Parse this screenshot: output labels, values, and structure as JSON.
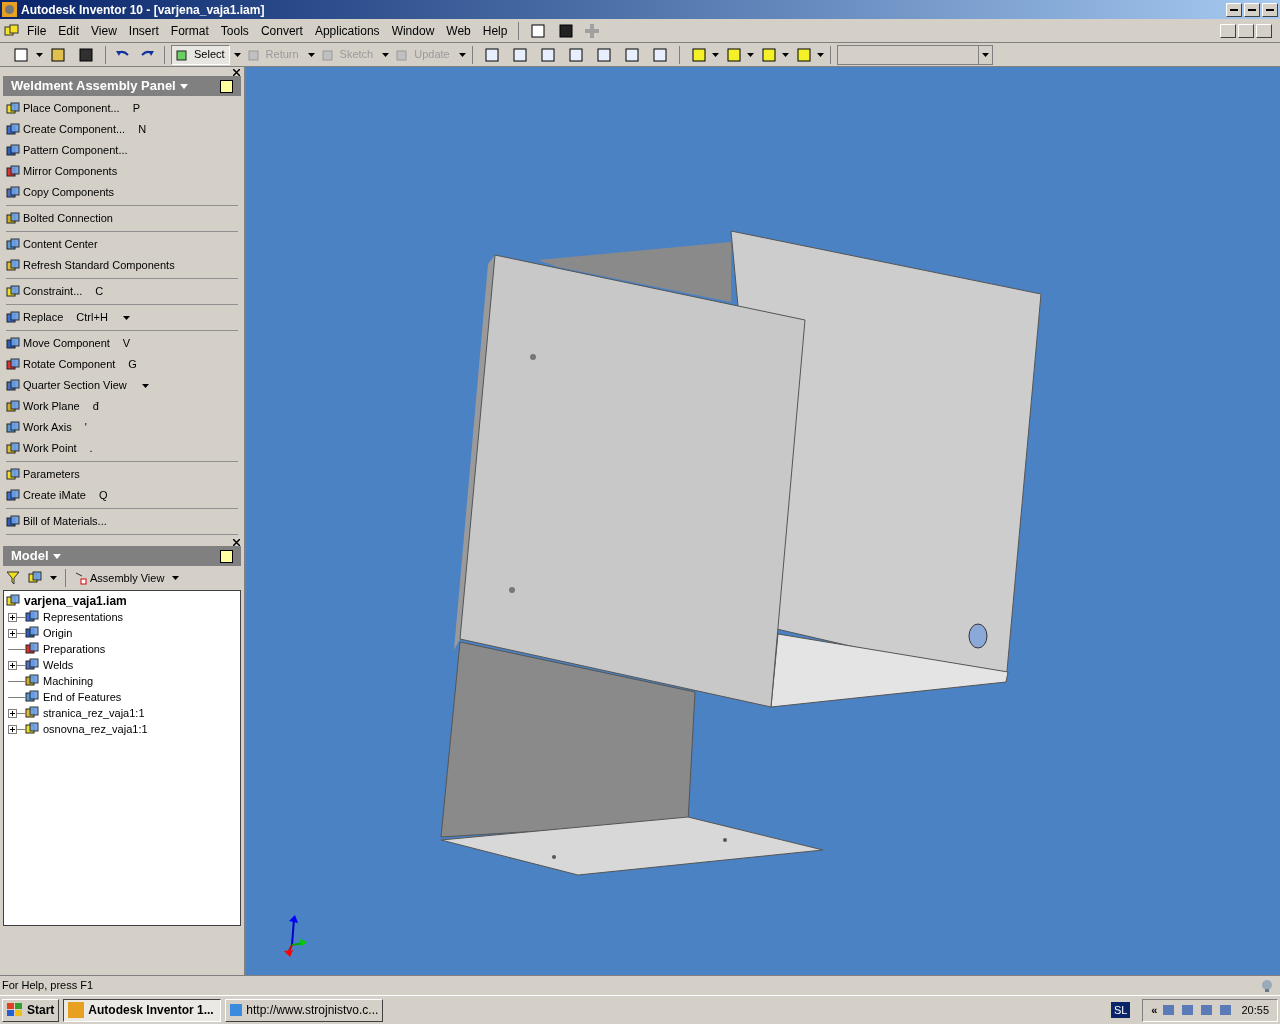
{
  "window": {
    "title": "Autodesk Inventor 10 - [varjena_vaja1.iam]"
  },
  "menu": [
    "File",
    "Edit",
    "View",
    "Insert",
    "Format",
    "Tools",
    "Convert",
    "Applications",
    "Window",
    "Web",
    "Help"
  ],
  "toolbar": [
    {
      "label": "Select",
      "selected": true,
      "disabled": false
    },
    {
      "label": "Return",
      "selected": false,
      "disabled": true
    },
    {
      "label": "Sketch",
      "selected": false,
      "disabled": true
    },
    {
      "label": "Update",
      "selected": false,
      "disabled": true
    }
  ],
  "panel": {
    "title": "Weldment Assembly Panel",
    "groups": [
      [
        {
          "label": "Place Component...",
          "shortcut": "P",
          "dropdown": false
        },
        {
          "label": "Create Component...",
          "shortcut": "N",
          "dropdown": false
        },
        {
          "label": "Pattern Component...",
          "dropdown": false
        },
        {
          "label": "Mirror Components",
          "dropdown": false
        },
        {
          "label": "Copy Components",
          "dropdown": false
        }
      ],
      [
        {
          "label": "Bolted Connection",
          "dropdown": false
        }
      ],
      [
        {
          "label": "Content Center",
          "dropdown": false
        },
        {
          "label": "Refresh Standard Components",
          "dropdown": false
        }
      ],
      [
        {
          "label": "Constraint...",
          "shortcut": "C",
          "dropdown": false
        }
      ],
      [
        {
          "label": "Replace",
          "shortcut": "Ctrl+H",
          "dropdown": true
        }
      ],
      [
        {
          "label": "Move Component",
          "shortcut": "V",
          "dropdown": false
        },
        {
          "label": "Rotate Component",
          "shortcut": "G",
          "dropdown": false
        },
        {
          "label": "Quarter Section View",
          "dropdown": true
        },
        {
          "label": "Work Plane",
          "shortcut": "đ",
          "dropdown": false
        },
        {
          "label": "Work Axis",
          "shortcut": "'",
          "dropdown": false
        },
        {
          "label": "Work Point",
          "shortcut": ".",
          "dropdown": false
        }
      ],
      [
        {
          "label": "Parameters",
          "dropdown": false
        },
        {
          "label": "Create iMate",
          "shortcut": "Q",
          "dropdown": false
        }
      ],
      [
        {
          "label": "Bill of Materials...",
          "dropdown": false
        }
      ]
    ]
  },
  "model": {
    "title": "Model",
    "view": "Assembly View",
    "root": "varjena_vaja1.iam",
    "children": [
      {
        "label": "Representations",
        "collapsible": true
      },
      {
        "label": "Origin",
        "collapsible": true
      },
      {
        "label": "Preparations",
        "collapsible": false
      },
      {
        "label": "Welds",
        "collapsible": true
      },
      {
        "label": "Machining",
        "collapsible": false
      },
      {
        "label": "End of Features",
        "collapsible": false
      },
      {
        "label": "stranica_rez_vaja1:1",
        "collapsible": true
      },
      {
        "label": "osnovna_rez_vaja1:1",
        "collapsible": true
      }
    ]
  },
  "status_bar": "For Help, press F1",
  "taskbar": {
    "start": "Start",
    "tasks": [
      {
        "label": "Autodesk Inventor 1...",
        "selected": true
      },
      {
        "label": "http://www.strojnistvo.c...",
        "selected": false
      }
    ],
    "language": "SL",
    "chevron": "«",
    "time": "20:55"
  }
}
